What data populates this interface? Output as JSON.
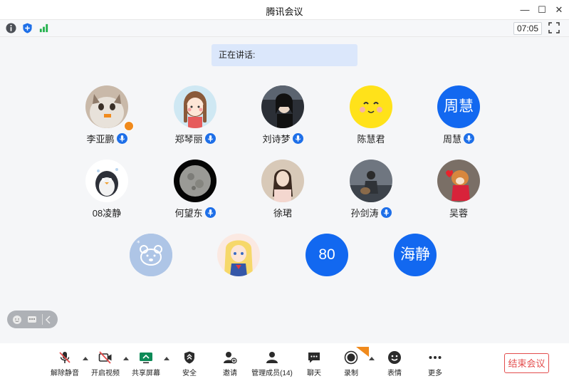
{
  "window": {
    "title": "腾讯会议",
    "minimize_glyph": "—",
    "maximize_glyph": "☐",
    "close_glyph": "✕"
  },
  "infobar": {
    "timer": "07:05",
    "icons": [
      "info-icon",
      "shield-icon",
      "signal-icon"
    ]
  },
  "stage": {
    "speaking_label": "正在讲话:"
  },
  "participants": [
    {
      "name": "李亚鹏",
      "mic": true,
      "host": true,
      "avatar": "cat-photo"
    },
    {
      "name": "郑琴丽",
      "mic": true,
      "avatar": "girl-drawing"
    },
    {
      "name": "刘诗梦",
      "mic": true,
      "avatar": "dark-photo"
    },
    {
      "name": "陈慧君",
      "mic": false,
      "avatar": "yellow-face"
    },
    {
      "name": "周慧",
      "mic": true,
      "avatar_text": "周慧",
      "avatar_color": "#1268f0"
    },
    {
      "name": "08凌静",
      "mic": false,
      "avatar": "penguin"
    },
    {
      "name": "何望东",
      "mic": true,
      "avatar": "moon"
    },
    {
      "name": "徐珺",
      "mic": false,
      "avatar": "girl-photo"
    },
    {
      "name": "孙剑涛",
      "mic": true,
      "avatar": "guitar-photo"
    },
    {
      "name": "吴蓉",
      "mic": false,
      "avatar": "dog-photo"
    },
    {
      "avatar": "bear-icon"
    },
    {
      "avatar": "anime-girl"
    },
    {
      "avatar_text": "80",
      "avatar_color": "#1268f0"
    },
    {
      "avatar_text": "海静",
      "avatar_color": "#1268f0"
    }
  ],
  "toolbar": {
    "unmute": "解除静音",
    "start_video": "开启视频",
    "share_screen": "共享屏幕",
    "security": "安全",
    "invite": "邀请",
    "manage_members": "管理成员(14)",
    "chat": "聊天",
    "record": "录制",
    "reactions": "表情",
    "more": "更多",
    "end_meeting": "结束会议",
    "record_badge": "NEW"
  },
  "colors": {
    "accent": "#1268f0",
    "danger": "#e34d4d",
    "speaking_bg": "#dbe7fb"
  }
}
